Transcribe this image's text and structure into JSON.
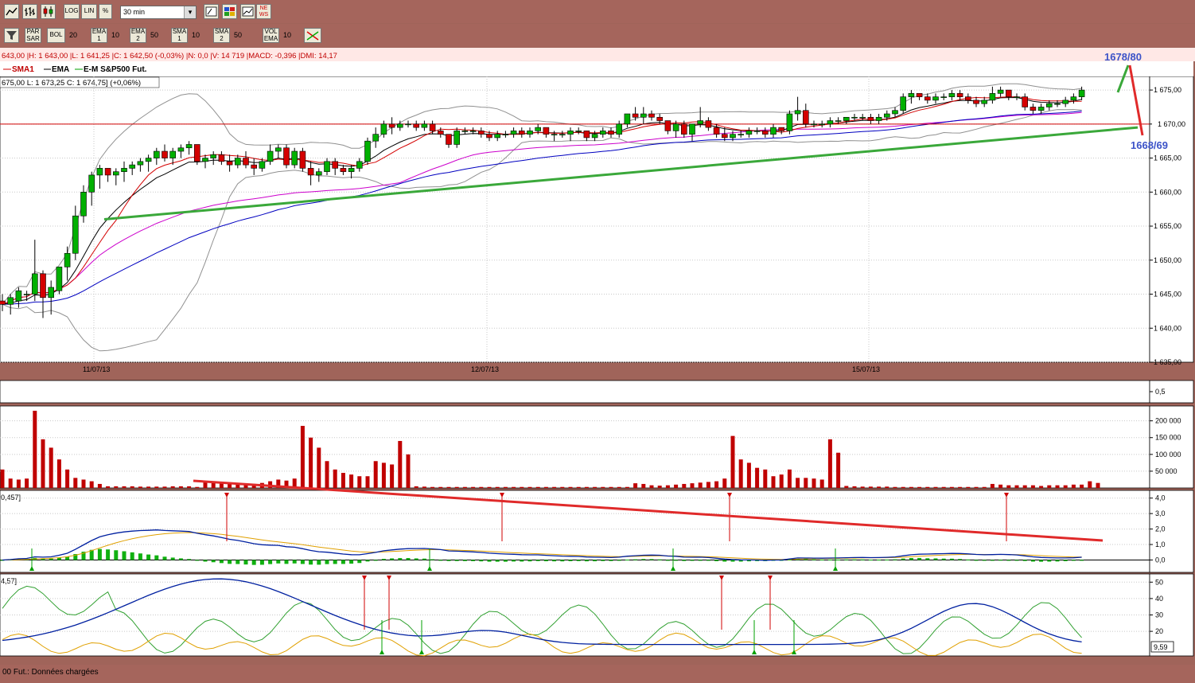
{
  "toolbar1": {
    "log_label": "LOG",
    "lin_label": "LIN",
    "pct_label": "%",
    "period": "30 min",
    "news_label": "NE WS"
  },
  "toolbar2": {
    "par_sar": "PAR SAR",
    "bol": "BOL",
    "bol_val": "20",
    "ema1": "EMA 1",
    "ema1_val": "10",
    "ema2": "EMA 2",
    "ema2_val": "50",
    "sma1": "SMA 1",
    "sma1_val": "10",
    "sma2": "SMA 2",
    "sma2_val": "50",
    "vol_ema": "VOL EMA",
    "vol_ema_val": "10"
  },
  "info_line": "643,00 |H: 1 643,00 |L: 1 641,25 |C: 1 642,50 (-0,03%) |N: 0,0 |V: 14 719 |MACD: -0,396 |DMI: 14,17",
  "legend": {
    "sma": "SMA1",
    "ema": "EMA",
    "instrument": "E-M S&P500 Fut."
  },
  "ohlc_line": "675,00 L: 1 673,25 C: 1 674,75] (+0,06%)",
  "annotations": {
    "target_up": "1678/80",
    "target_down": "1668/69"
  },
  "price_axis": {
    "ticks": [
      "1 675,00",
      "1 670,00",
      "1 665,00",
      "1 660,00",
      "1 655,00",
      "1 650,00",
      "1 645,00",
      "1 640,00",
      "1 635,00"
    ],
    "hline_label": "1 670,00"
  },
  "dates": [
    "11/07/13",
    "12/07/13",
    "15/07/13"
  ],
  "panel_small": {
    "tick": "0,5"
  },
  "volume_axis": [
    "200 000",
    "150 000",
    "100 000",
    "50 000"
  ],
  "macd_label": "0,457]",
  "macd_axis": [
    "4,0",
    "3,0",
    "2,0",
    "1,0",
    "0,0"
  ],
  "dmi_label": "4,57]",
  "dmi_axis": [
    "50",
    "40",
    "30",
    "20"
  ],
  "dmi_value": "9,59",
  "status": "00 Fut.: Données chargées",
  "colors": {
    "candle_up": "#00b000",
    "candle_down": "#d40000",
    "trend_green": "#3aa83a",
    "trend_red": "#e02a2a",
    "annotation": "#3c53c8",
    "background": "#ffffff",
    "frame": "#a0645a"
  },
  "chart_data": {
    "type": "candlestick",
    "title": "E-M S&P500 Fut.",
    "interval": "30 min",
    "ylim": [
      1635,
      1677
    ],
    "hline": 1670,
    "candles": [
      [
        1644,
        1645,
        1642.5,
        1643.5
      ],
      [
        1643.5,
        1645,
        1642,
        1644.5
      ],
      [
        1644,
        1646,
        1643,
        1645.5
      ],
      [
        1645,
        1645.5,
        1644,
        1645
      ],
      [
        1645,
        1653,
        1644,
        1648
      ],
      [
        1648,
        1648.5,
        1641.5,
        1644.5
      ],
      [
        1644.5,
        1647,
        1642,
        1646
      ],
      [
        1645.5,
        1649,
        1645,
        1649
      ],
      [
        1649,
        1652,
        1647,
        1651
      ],
      [
        1651,
        1658,
        1650,
        1656.5
      ],
      [
        1656.5,
        1661,
        1655.5,
        1660
      ],
      [
        1660,
        1663,
        1658,
        1662.5
      ],
      [
        1662.5,
        1664,
        1660.5,
        1663.5
      ],
      [
        1663.5,
        1663.5,
        1661.5,
        1662.5
      ],
      [
        1662.5,
        1663.5,
        1661,
        1663
      ],
      [
        1663,
        1664.5,
        1661.5,
        1663.5
      ],
      [
        1663.5,
        1664.5,
        1662.5,
        1664
      ],
      [
        1664,
        1665,
        1663,
        1664.5
      ],
      [
        1664.5,
        1665.5,
        1663,
        1665
      ],
      [
        1665,
        1666.5,
        1664,
        1666
      ],
      [
        1666,
        1667,
        1664.5,
        1665
      ],
      [
        1665,
        1666.5,
        1664,
        1666
      ],
      [
        1666,
        1667,
        1665,
        1666.5
      ],
      [
        1666.5,
        1667.5,
        1665.5,
        1667
      ],
      [
        1667,
        1667,
        1664,
        1664.5
      ],
      [
        1664.5,
        1665.5,
        1663.5,
        1665
      ],
      [
        1665,
        1666,
        1664,
        1665.5
      ],
      [
        1665.5,
        1666,
        1664,
        1664.5
      ],
      [
        1664.5,
        1665.5,
        1663,
        1664
      ],
      [
        1664,
        1665.5,
        1663.5,
        1665
      ],
      [
        1665,
        1666,
        1663.5,
        1664
      ],
      [
        1664,
        1665,
        1662.5,
        1663.5
      ],
      [
        1663.5,
        1665,
        1663,
        1664.5
      ],
      [
        1664.5,
        1667,
        1664,
        1666
      ],
      [
        1666,
        1667,
        1665,
        1666.5
      ],
      [
        1666.5,
        1667,
        1663.5,
        1664
      ],
      [
        1664,
        1666.5,
        1663.5,
        1666
      ],
      [
        1666,
        1666.5,
        1663,
        1663.5
      ],
      [
        1663.5,
        1664.5,
        1661,
        1662.5
      ],
      [
        1662.5,
        1663.5,
        1661.5,
        1663
      ],
      [
        1663,
        1665,
        1662.5,
        1664.5
      ],
      [
        1664.5,
        1665,
        1662.5,
        1663.5
      ],
      [
        1663.5,
        1664,
        1662.5,
        1663
      ],
      [
        1663,
        1664,
        1662,
        1663.5
      ],
      [
        1663.5,
        1665,
        1663,
        1664.5
      ],
      [
        1664.5,
        1668,
        1664,
        1667.5
      ],
      [
        1667.5,
        1669.5,
        1666.5,
        1668.5
      ],
      [
        1668.5,
        1670.5,
        1668,
        1670
      ],
      [
        1670,
        1671,
        1668.5,
        1669.5
      ],
      [
        1669.5,
        1670.5,
        1669,
        1670
      ],
      [
        1670,
        1670.5,
        1669.5,
        1670
      ],
      [
        1670,
        1670.5,
        1669,
        1669.5
      ],
      [
        1669.5,
        1670.5,
        1669,
        1670
      ],
      [
        1670,
        1670.5,
        1668.5,
        1669
      ],
      [
        1669,
        1669.5,
        1668,
        1668.5
      ],
      [
        1668.5,
        1668.5,
        1666.5,
        1667
      ],
      [
        1667,
        1669.5,
        1666.5,
        1669
      ],
      [
        1669,
        1669.5,
        1668.5,
        1669
      ],
      [
        1669,
        1669.5,
        1668.5,
        1669
      ],
      [
        1669,
        1669.5,
        1668,
        1668.5
      ],
      [
        1668.5,
        1669,
        1667.5,
        1668
      ],
      [
        1668,
        1669,
        1667.5,
        1668.5
      ],
      [
        1668.5,
        1669,
        1668,
        1668.5
      ],
      [
        1668.5,
        1669.5,
        1668,
        1669
      ],
      [
        1669,
        1669.5,
        1668,
        1668.5
      ],
      [
        1668.5,
        1669.5,
        1668,
        1669
      ],
      [
        1669,
        1670,
        1668.5,
        1669.5
      ],
      [
        1669.5,
        1669.5,
        1668,
        1668.5
      ],
      [
        1668.5,
        1669,
        1667.5,
        1668.5
      ],
      [
        1668.5,
        1669,
        1668,
        1668.5
      ],
      [
        1668.5,
        1669.5,
        1667.5,
        1669
      ],
      [
        1669,
        1669.5,
        1668.5,
        1669
      ],
      [
        1669,
        1669,
        1667.5,
        1668
      ],
      [
        1668,
        1669,
        1667.5,
        1668.5
      ],
      [
        1668.5,
        1669.5,
        1668,
        1669
      ],
      [
        1669,
        1669.5,
        1668,
        1668.5
      ],
      [
        1668.5,
        1670.5,
        1668,
        1670
      ],
      [
        1670,
        1671.5,
        1669.5,
        1671.5
      ],
      [
        1671.5,
        1672.5,
        1670.5,
        1671
      ],
      [
        1671,
        1672.5,
        1670,
        1671.5
      ],
      [
        1671.5,
        1672,
        1670.5,
        1671
      ],
      [
        1671,
        1671.5,
        1670,
        1670.5
      ],
      [
        1670.5,
        1670.5,
        1668.5,
        1669
      ],
      [
        1669,
        1670.5,
        1668,
        1670
      ],
      [
        1670,
        1670.5,
        1668,
        1668.5
      ],
      [
        1668.5,
        1670,
        1667.5,
        1670
      ],
      [
        1670,
        1672.5,
        1669.5,
        1670.5
      ],
      [
        1670.5,
        1671,
        1669,
        1669.5
      ],
      [
        1669.5,
        1670,
        1668,
        1668.5
      ],
      [
        1668.5,
        1669.5,
        1667.5,
        1668
      ],
      [
        1668,
        1669,
        1667.5,
        1668.5
      ],
      [
        1668.5,
        1669,
        1668,
        1668.5
      ],
      [
        1668.5,
        1669.5,
        1668,
        1669
      ],
      [
        1669,
        1669.5,
        1668.5,
        1669
      ],
      [
        1669,
        1669.5,
        1668,
        1668.5
      ],
      [
        1668.5,
        1670,
        1668,
        1669.5
      ],
      [
        1669.5,
        1669.5,
        1668.5,
        1669
      ],
      [
        1669,
        1672,
        1668.5,
        1671.5
      ],
      [
        1671.5,
        1674,
        1670.5,
        1672
      ],
      [
        1672,
        1673,
        1669.5,
        1670
      ],
      [
        1670,
        1670.5,
        1669.5,
        1670
      ],
      [
        1670,
        1670.5,
        1669.5,
        1670
      ],
      [
        1670,
        1671,
        1669.5,
        1670.5
      ],
      [
        1670.5,
        1671,
        1670,
        1670.5
      ],
      [
        1670.5,
        1671,
        1670,
        1671
      ],
      [
        1671,
        1671.5,
        1670.5,
        1671
      ],
      [
        1671,
        1671.5,
        1670.5,
        1671
      ],
      [
        1671,
        1671.5,
        1670,
        1670.5
      ],
      [
        1670.5,
        1671.5,
        1670,
        1671
      ],
      [
        1671,
        1672,
        1670.5,
        1671.5
      ],
      [
        1671.5,
        1672.5,
        1671,
        1672
      ],
      [
        1672,
        1674.5,
        1671.5,
        1674
      ],
      [
        1674,
        1675,
        1673,
        1674.5
      ],
      [
        1674.5,
        1674.5,
        1673.5,
        1674
      ],
      [
        1674,
        1674.5,
        1673,
        1673.5
      ],
      [
        1673.5,
        1674.5,
        1673,
        1674
      ],
      [
        1674,
        1674.5,
        1673.5,
        1674
      ],
      [
        1674,
        1675,
        1673.5,
        1674.5
      ],
      [
        1674.5,
        1675,
        1673.5,
        1674
      ],
      [
        1674,
        1674.5,
        1673,
        1673.5
      ],
      [
        1673.5,
        1674,
        1672.5,
        1673
      ],
      [
        1673,
        1674,
        1672.5,
        1673.5
      ],
      [
        1673.5,
        1675.5,
        1673,
        1674.5
      ],
      [
        1674.5,
        1675.5,
        1674,
        1675
      ],
      [
        1675,
        1675,
        1673.5,
        1674
      ],
      [
        1674,
        1674.5,
        1673.5,
        1674
      ],
      [
        1674,
        1674.5,
        1672,
        1672.5
      ],
      [
        1672.5,
        1673,
        1671.5,
        1672
      ],
      [
        1672,
        1673,
        1671.5,
        1672.5
      ],
      [
        1672.5,
        1673.5,
        1672,
        1673
      ],
      [
        1673,
        1673.5,
        1672.5,
        1673
      ],
      [
        1673,
        1674,
        1672.5,
        1673.5
      ],
      [
        1673.5,
        1674.5,
        1673,
        1674
      ],
      [
        1674,
        1675.5,
        1673.5,
        1675
      ]
    ],
    "support_line": [
      [
        1656,
        1669.5
      ]
    ],
    "volume_ylim": [
      0,
      230000
    ],
    "volume": [
      55000,
      28000,
      25000,
      28000,
      230000,
      145000,
      120000,
      85000,
      55000,
      30000,
      25000,
      20000,
      12000,
      5000,
      5000,
      5000,
      5000,
      4000,
      4000,
      4000,
      4000,
      5000,
      5000,
      5000,
      3000,
      18000,
      16000,
      14000,
      12000,
      10000,
      12000,
      12000,
      15000,
      20000,
      25000,
      22000,
      28000,
      185000,
      150000,
      120000,
      80000,
      55000,
      45000,
      40000,
      35000,
      35000,
      80000,
      75000,
      70000,
      140000,
      100000,
      5000,
      4000,
      3000,
      3000,
      3000,
      3000,
      3000,
      3000,
      3000,
      3000,
      3000,
      3000,
      3000,
      3000,
      3000,
      3000,
      3000,
      3000,
      3000,
      3000,
      3000,
      3000,
      3000,
      3000,
      3000,
      3000,
      3000,
      14000,
      12000,
      8000,
      7000,
      8000,
      10000,
      12000,
      14000,
      16000,
      18000,
      20000,
      28000,
      155000,
      85000,
      75000,
      60000,
      55000,
      35000,
      40000,
      55000,
      30000,
      30000,
      28000,
      25000,
      145000,
      105000,
      6000,
      5000,
      4000,
      4000,
      4000,
      4000,
      3000,
      3000,
      3000,
      3000,
      3000,
      3000,
      3000,
      3000,
      3000,
      3000,
      3000,
      3000,
      12000,
      10000,
      8000,
      8000,
      8000,
      8000,
      6000,
      8000,
      8000,
      8000,
      10000,
      10000,
      20000,
      15000
    ],
    "macd_ylim": [
      -0.8,
      4.5
    ],
    "dmi_ylim": [
      5,
      55
    ],
    "red_trend_macd": [
      [
        0.45,
        1.25
      ]
    ],
    "series": [
      {
        "name": "SMA1",
        "color": "#d40000"
      },
      {
        "name": "EMA",
        "color": "#000000"
      }
    ]
  }
}
